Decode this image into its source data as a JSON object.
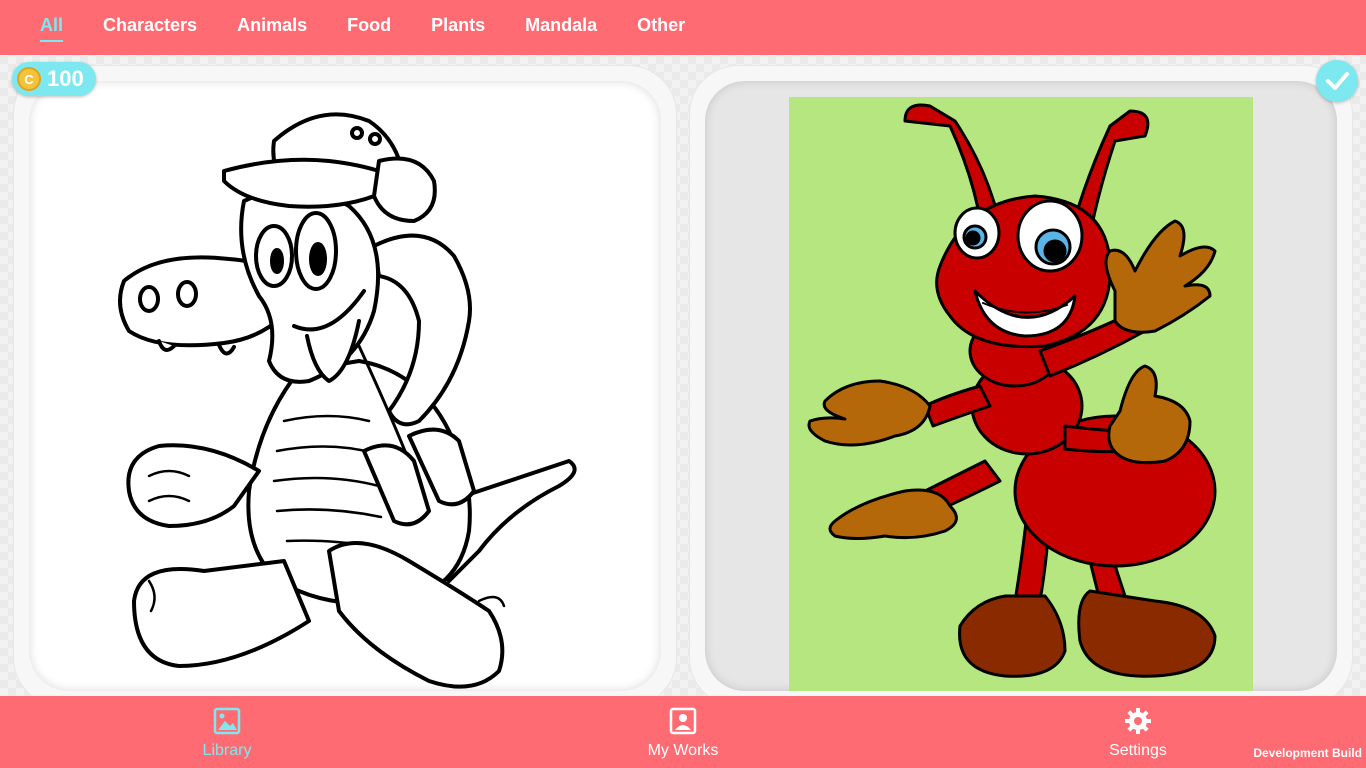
{
  "tabs": [
    {
      "label": "All",
      "active": true
    },
    {
      "label": "Characters"
    },
    {
      "label": "Animals"
    },
    {
      "label": "Food"
    },
    {
      "label": "Plants"
    },
    {
      "label": "Mandala"
    },
    {
      "label": "Other"
    }
  ],
  "coins": {
    "icon": "coin-icon",
    "symbol": "C",
    "count": "100"
  },
  "cards": [
    {
      "name": "crocodile-coloring-page",
      "state": "uncolored line art"
    },
    {
      "name": "ant-coloring-page",
      "state": "colored",
      "completed_icon": "checkmark-icon"
    }
  ],
  "bottom_nav": [
    {
      "label": "Library",
      "icon": "image-icon",
      "active": true
    },
    {
      "label": "My Works",
      "icon": "portrait-icon"
    },
    {
      "label": "Settings",
      "icon": "gear-icon"
    }
  ],
  "footer": {
    "dev_build": "Development Build"
  },
  "colors": {
    "bar": "#ff6b72",
    "accent": "#7ee8f0",
    "ant_red": "#c80000",
    "glove_brown": "#b5680a",
    "shoe_brown": "#8a2a00",
    "ant_background": "#b5e67f"
  }
}
